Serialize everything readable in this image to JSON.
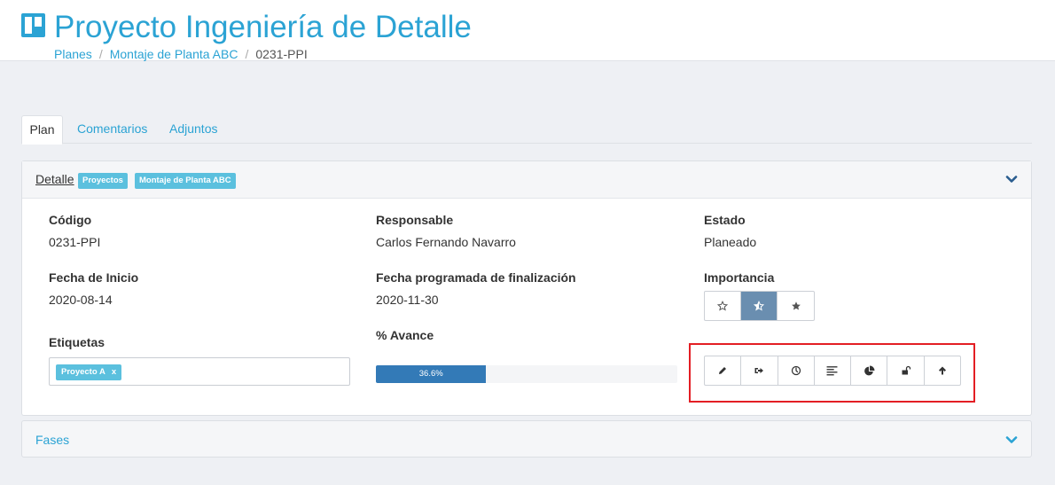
{
  "header": {
    "title": "Proyecto Ingeniería de Detalle",
    "logo_icon": "board-icon",
    "breadcrumb": [
      "Planes",
      "Montaje de Planta ABC",
      "0231-PPI"
    ]
  },
  "tabs": [
    "Plan",
    "Comentarios",
    "Adjuntos"
  ],
  "detail_panel": {
    "title": "Detalle",
    "badges": [
      "Proyectos",
      "Montaje de Planta ABC"
    ],
    "toggle_icon": "chevron-down-icon"
  },
  "fields": {
    "codigo": {
      "label": "Código",
      "value": "0231-PPI"
    },
    "responsable": {
      "label": "Responsable",
      "value": "Carlos Fernando Navarro"
    },
    "estado": {
      "label": "Estado",
      "value": "Planeado"
    },
    "fecha_inicio": {
      "label": "Fecha de Inicio",
      "value": "2020-08-14"
    },
    "fecha_fin": {
      "label": "Fecha programada de finalización",
      "value": "2020-11-30"
    },
    "importancia": {
      "label": "Importancia",
      "options": [
        "star-empty-icon",
        "star-half-icon",
        "star-full-icon"
      ],
      "selected_index": 1
    },
    "etiquetas": {
      "label": "Etiquetas",
      "tags": [
        {
          "text": "Proyecto A",
          "remove": "x"
        }
      ]
    },
    "avance": {
      "label": "% Avance",
      "percent": 36.6,
      "text": "36.6%"
    }
  },
  "toolbar": {
    "buttons": [
      "pencil-icon",
      "sign-out-icon",
      "clock-icon",
      "align-left-icon",
      "pie-chart-icon",
      "unlock-icon",
      "arrow-up-icon"
    ]
  },
  "fases_panel": {
    "title": "Fases",
    "toggle_icon": "chevron-down-icon"
  },
  "colors": {
    "accent": "#2ba3d4",
    "badge": "#5bc0de",
    "progress": "#337ab7",
    "highlight": "#e31e24",
    "star_active": "#6a8eb0"
  }
}
